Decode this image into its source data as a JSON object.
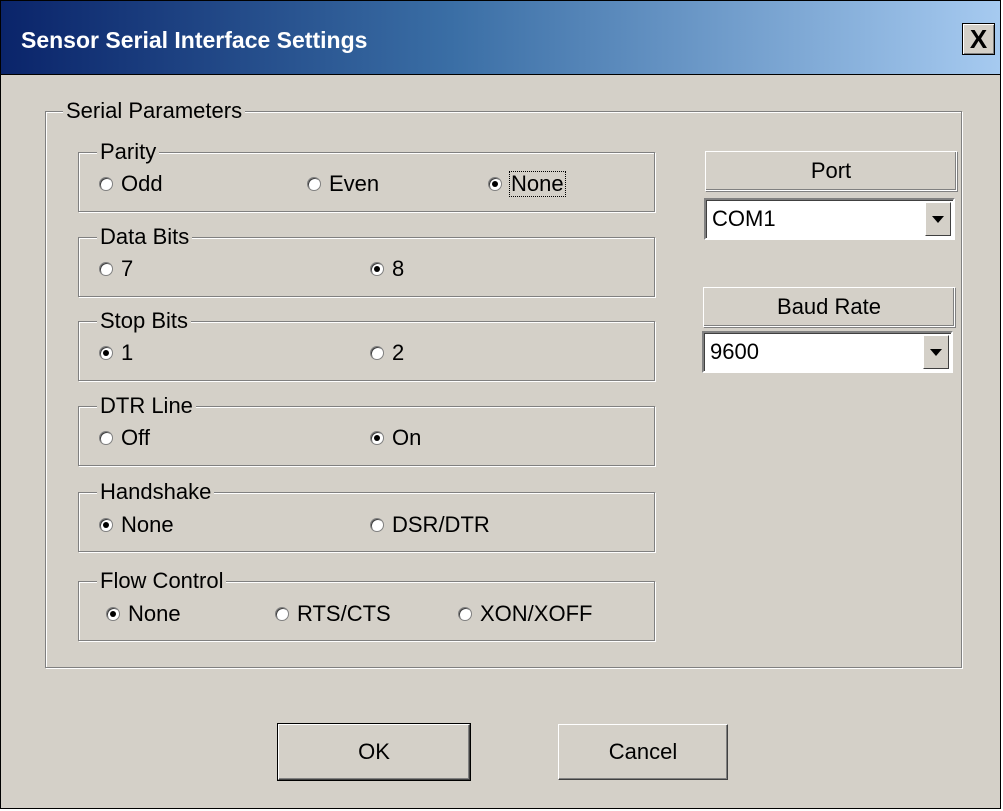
{
  "window": {
    "title": "Sensor Serial Interface Settings",
    "close_label": "X"
  },
  "serial_parameters": {
    "label": "Serial Parameters",
    "parity": {
      "label": "Parity",
      "options": [
        "Odd",
        "Even",
        "None"
      ],
      "selected": "None"
    },
    "data_bits": {
      "label": "Data Bits",
      "options": [
        "7",
        "8"
      ],
      "selected": "8"
    },
    "stop_bits": {
      "label": "Stop Bits",
      "options": [
        "1",
        "2"
      ],
      "selected": "1"
    },
    "dtr_line": {
      "label": "DTR Line",
      "options": [
        "Off",
        "On"
      ],
      "selected": "On"
    },
    "handshake": {
      "label": "Handshake",
      "options": [
        "None",
        "DSR/DTR"
      ],
      "selected": "None"
    },
    "flow_control": {
      "label": "Flow Control",
      "options": [
        "None",
        "RTS/CTS",
        "XON/XOFF"
      ],
      "selected": "None"
    }
  },
  "port": {
    "label": "Port",
    "value": "COM1"
  },
  "baud_rate": {
    "label": "Baud Rate",
    "value": "9600"
  },
  "buttons": {
    "ok": "OK",
    "cancel": "Cancel"
  }
}
